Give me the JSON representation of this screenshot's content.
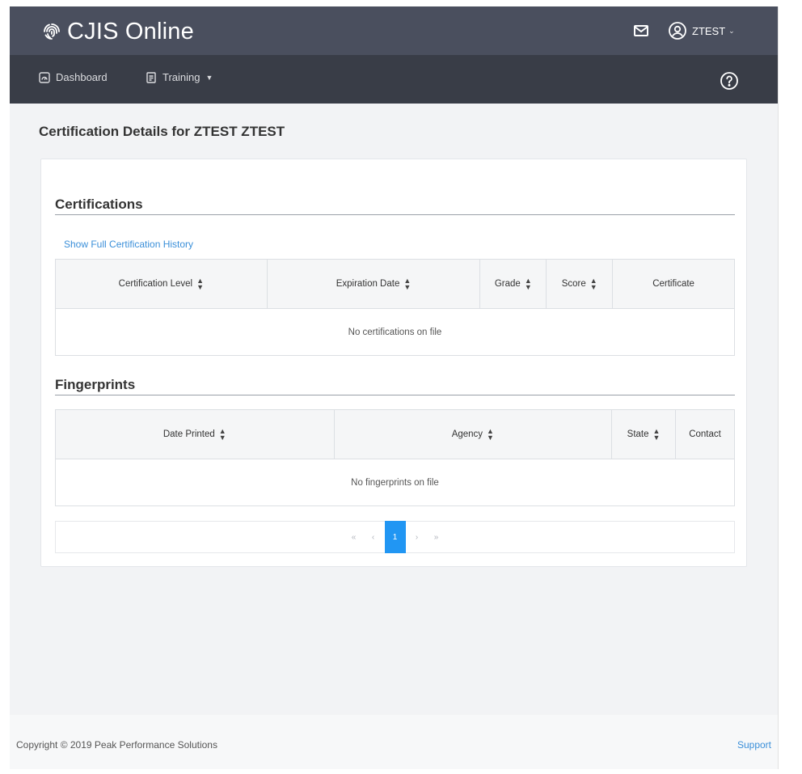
{
  "header": {
    "app_title": "CJIS Online",
    "user_name": "ZTEST",
    "user_chevron": "⌄"
  },
  "nav": {
    "dashboard": "Dashboard",
    "training": "Training",
    "training_caret": "▼"
  },
  "page": {
    "title": "Certification Details for ZTEST ZTEST"
  },
  "certifications": {
    "heading": "Certifications",
    "history_link": "Show Full Certification History",
    "columns": [
      "Certification Level",
      "Expiration Date",
      "Grade",
      "Score",
      "Certificate"
    ],
    "empty_message": "No certifications on file"
  },
  "fingerprints": {
    "heading": "Fingerprints",
    "columns": [
      "Date Printed",
      "Agency",
      "State",
      "Contact"
    ],
    "empty_message": "No fingerprints on file"
  },
  "pagination": {
    "first": "«",
    "prev": "‹",
    "current_page": "1",
    "next": "›",
    "last": "»"
  },
  "footer": {
    "copyright": "Copyright © 2019 Peak Performance Solutions",
    "support": "Support"
  },
  "colors": {
    "topbar": "#4a4f5e",
    "navbar": "#393d47",
    "accent": "#2196f3",
    "link": "#3a8fd9"
  },
  "icons": [
    "fingerprint-logo-icon",
    "mail-icon",
    "user-circle-icon",
    "dashboard-icon",
    "document-icon",
    "help-icon",
    "sort-icon"
  ]
}
